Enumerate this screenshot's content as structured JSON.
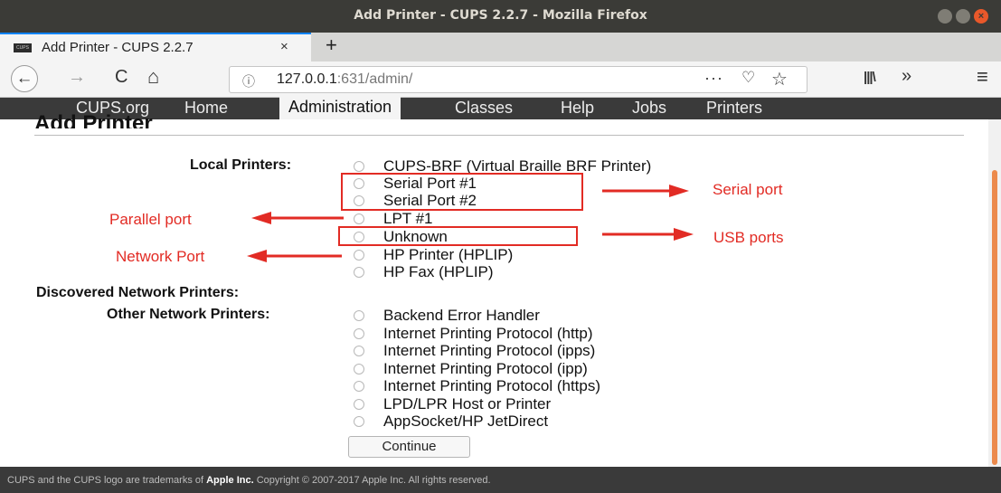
{
  "window": {
    "title": "Add Printer - CUPS 2.2.7 - Mozilla Firefox"
  },
  "tab": {
    "favicon_text": "CUPS",
    "title": "Add Printer - CUPS 2.2.7",
    "close": "×",
    "new": "+"
  },
  "nav": {
    "url_host": "127.0.0.1",
    "url_rest": ":631/admin/",
    "back": "←",
    "forward": "→",
    "reload": "C",
    "home": "⌂",
    "info": "ⓘ",
    "more": "···",
    "pocket": "♡",
    "star": "☆",
    "library": "|||\\",
    "overflow": "»",
    "menu": "≡"
  },
  "cups_menu": [
    {
      "label": "CUPS.org",
      "active": false
    },
    {
      "label": "Home",
      "active": false
    },
    {
      "label": "Administration",
      "active": true
    },
    {
      "label": "Classes",
      "active": false
    },
    {
      "label": "Help",
      "active": false
    },
    {
      "label": "Jobs",
      "active": false
    },
    {
      "label": "Printers",
      "active": false
    }
  ],
  "page": {
    "heading": "Add Printer",
    "local_label": "Local Printers:",
    "local_printers": [
      "CUPS-BRF (Virtual Braille BRF Printer)",
      "Serial Port #1",
      "Serial Port #2",
      "LPT #1",
      "Unknown",
      "HP Printer (HPLIP)",
      "HP Fax (HPLIP)"
    ],
    "discovered_label": "Discovered Network Printers:",
    "other_label": "Other Network Printers:",
    "other_printers": [
      "Backend Error Handler",
      "Internet Printing Protocol (http)",
      "Internet Printing Protocol (ipps)",
      "Internet Printing Protocol (ipp)",
      "Internet Printing Protocol (https)",
      "LPD/LPR Host or Printer",
      "AppSocket/HP JetDirect"
    ],
    "continue_label": "Continue"
  },
  "annotations": {
    "serial_port": "Serial port",
    "parallel_port": "Parallel port",
    "usb_ports": "USB ports",
    "network_port": "Network Port",
    "color": "#e22b24"
  },
  "footer": {
    "prefix": "CUPS and the CUPS logo are trademarks of ",
    "apple": "Apple Inc.",
    "suffix": " Copyright © 2007-2017 Apple Inc. All rights reserved."
  }
}
